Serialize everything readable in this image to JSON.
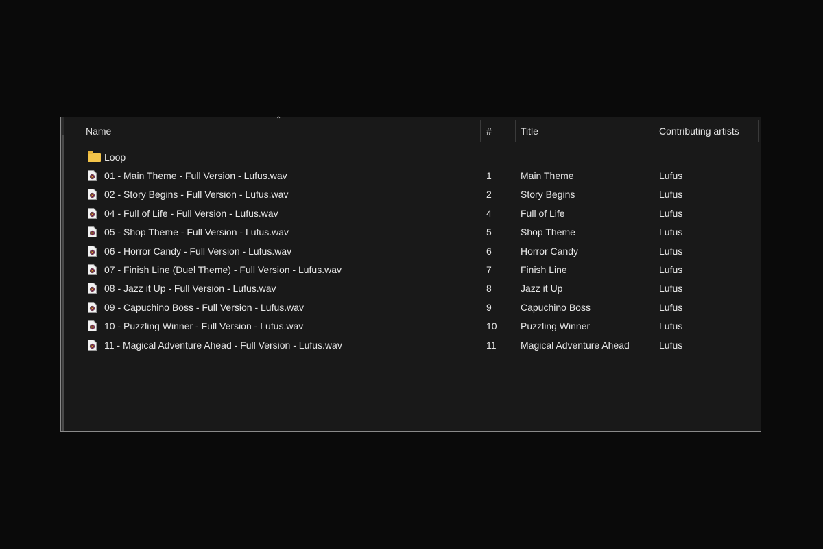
{
  "columns": {
    "name": "Name",
    "number": "#",
    "title": "Title",
    "artists": "Contributing artists"
  },
  "folder": {
    "name": "Loop"
  },
  "files": [
    {
      "name": "01 - Main Theme - Full Version - Lufus.wav",
      "number": "1",
      "title": "Main Theme",
      "artist": "Lufus"
    },
    {
      "name": "02 - Story Begins - Full Version - Lufus.wav",
      "number": "2",
      "title": "Story Begins",
      "artist": "Lufus"
    },
    {
      "name": "04 - Full of Life - Full Version - Lufus.wav",
      "number": "4",
      "title": "Full of Life",
      "artist": "Lufus"
    },
    {
      "name": "05 - Shop Theme - Full Version - Lufus.wav",
      "number": "5",
      "title": "Shop Theme",
      "artist": "Lufus"
    },
    {
      "name": "06 - Horror Candy - Full Version - Lufus.wav",
      "number": "6",
      "title": "Horror Candy",
      "artist": "Lufus"
    },
    {
      "name": "07 - Finish Line (Duel Theme) - Full Version - Lufus.wav",
      "number": "7",
      "title": "Finish Line",
      "artist": "Lufus"
    },
    {
      "name": "08 - Jazz it Up - Full Version - Lufus.wav",
      "number": "8",
      "title": "Jazz it Up",
      "artist": "Lufus"
    },
    {
      "name": "09 - Capuchino Boss - Full Version - Lufus.wav",
      "number": "9",
      "title": "Capuchino Boss",
      "artist": "Lufus"
    },
    {
      "name": "10 - Puzzling Winner - Full Version - Lufus.wav",
      "number": "10",
      "title": "Puzzling Winner",
      "artist": "Lufus"
    },
    {
      "name": "11 - Magical Adventure Ahead - Full Version - Lufus.wav",
      "number": "11",
      "title": "Magical Adventure Ahead",
      "artist": "Lufus"
    }
  ]
}
